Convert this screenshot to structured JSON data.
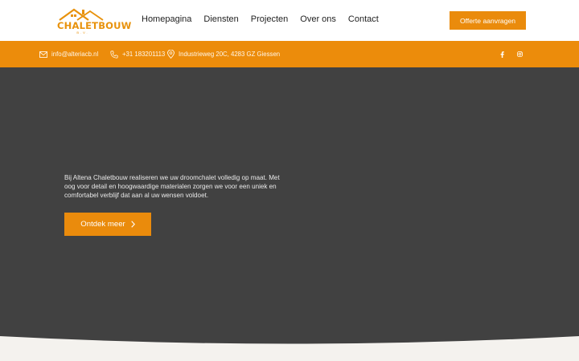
{
  "brand": {
    "logo_text": "CHALETBOUW",
    "logo_sub": "B.V."
  },
  "nav": {
    "items": [
      {
        "label": "Homepagina"
      },
      {
        "label": "Diensten"
      },
      {
        "label": "Projecten"
      },
      {
        "label": "Over ons"
      },
      {
        "label": "Contact"
      }
    ]
  },
  "header_cta": {
    "label": "Offerte aanvragen"
  },
  "topbar": {
    "email": "info@alteriacb.nl",
    "phone": "+31 183201113",
    "address": "Industrieweg 20C, 4283 GZ Giessen",
    "socials": [
      {
        "icon": "facebook-icon"
      },
      {
        "icon": "instagram-icon"
      }
    ]
  },
  "hero": {
    "paragraph": "Bij Altena Chaletbouw realiseren we uw droomchalet volledig op maat. Met oog voor detail en hoogwaardige materialen zorgen we voor een uniek en comfortabel verblijf dat aan al uw wensen voldoet.",
    "button_label": "Ontdek meer"
  },
  "colors": {
    "accent": "#ec8c0b",
    "hero_background": "#414141",
    "wave": "#f4f2ee",
    "nav_text": "#1f1f1f"
  }
}
